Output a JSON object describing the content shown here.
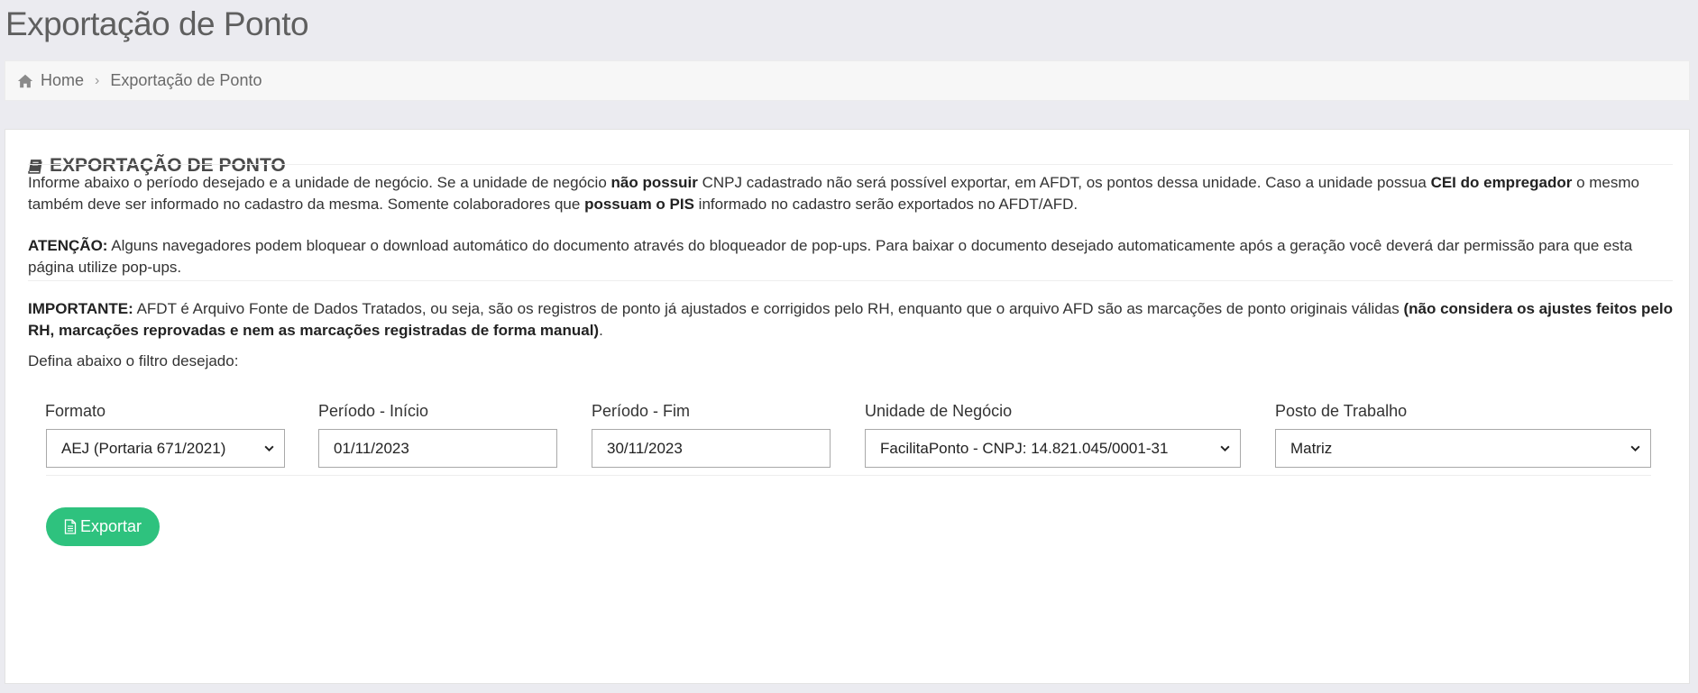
{
  "page": {
    "title": "Exportação de Ponto"
  },
  "breadcrumb": {
    "home": "Home",
    "current": "Exportação de Ponto"
  },
  "panel": {
    "title": "EXPORTAÇÃO DE PONTO",
    "intro": {
      "p1": "Informe abaixo o período desejado e a unidade de negócio. Se a unidade de negócio ",
      "b1": "não possuir",
      "p2": " CNPJ cadastrado não será possível exportar, em AFDT, os pontos dessa unidade. Caso a unidade possua ",
      "b2": "CEI do empregador",
      "p3": " o mesmo também deve ser informado no cadastro da mesma. Somente colaboradores que ",
      "b3": "possuam o PIS",
      "p4": " informado no cadastro serão exportados no AFDT/AFD."
    },
    "attention": {
      "label": "ATENÇÃO:",
      "text": " Alguns navegadores podem bloquear o download automático do documento através do bloqueador de pop-ups. Para baixar o documento desejado automaticamente após a geração você deverá dar permissão para que esta página utilize pop-ups."
    },
    "important": {
      "label": "IMPORTANTE:",
      "text": " AFDT é Arquivo Fonte de Dados Tratados, ou seja, são os registros de ponto já ajustados e corrigidos pelo RH, enquanto que o arquivo AFD são as marcações de ponto originais válidas ",
      "bold": "(não considera os ajustes feitos pelo RH, marcações reprovadas e nem as marcações registradas de forma manual)",
      "end": "."
    },
    "filter_prompt": "Defina abaixo o filtro desejado:"
  },
  "form": {
    "formato": {
      "label": "Formato",
      "value": "AEJ (Portaria 671/2021)"
    },
    "inicio": {
      "label": "Período - Início",
      "value": "01/11/2023"
    },
    "fim": {
      "label": "Período - Fim",
      "value": "30/11/2023"
    },
    "unidade": {
      "label": "Unidade de Negócio",
      "value": "FacilitaPonto - CNPJ: 14.821.045/0001-31"
    },
    "posto": {
      "label": "Posto de Trabalho",
      "value": "Matriz"
    },
    "export_label": "Exportar"
  },
  "colors": {
    "accent": "#2ec27e",
    "background": "#ebebf0"
  },
  "icons": {
    "home": "home-icon",
    "book": "book-icon",
    "file": "file-icon",
    "chevron": "chevron-down-icon"
  }
}
